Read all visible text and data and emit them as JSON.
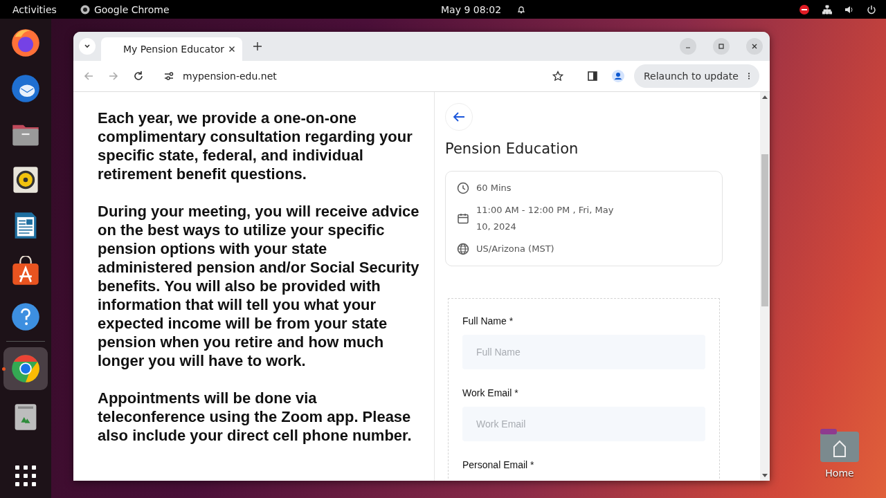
{
  "top_bar": {
    "activities": "Activities",
    "app_name": "Google Chrome",
    "clock": "May 9  08:02"
  },
  "dock": {
    "items": [
      {
        "kind": "firefox",
        "active": false
      },
      {
        "kind": "thunderbird",
        "active": false
      },
      {
        "kind": "files",
        "active": false
      },
      {
        "kind": "rhythmbox",
        "active": false
      },
      {
        "kind": "writer",
        "active": false
      },
      {
        "kind": "appcenter",
        "active": false
      },
      {
        "kind": "help",
        "active": false
      },
      {
        "kind": "chrome",
        "active": true
      },
      {
        "kind": "trash",
        "active": false
      }
    ]
  },
  "desktop": {
    "home_label": "Home"
  },
  "browser": {
    "tab_title": "My Pension Educator",
    "url": "mypension-edu.net",
    "relaunch": "Relaunch to update"
  },
  "page": {
    "paragraphs": [
      "Each year, we provide a one-on-one complimentary consultation regarding your specific state, federal, and individual retirement benefit questions.",
      "During your meeting, you will receive advice on the best ways to utilize your specific pension options with your state administered pension and/or Social Security benefits. You will also be provided with information that will tell you what your expected income will be from your state pension when you retire and how much longer you will have to work.",
      "Appointments will be done via teleconference using the Zoom app. Please also include your direct cell phone number."
    ],
    "title": "Pension Education",
    "details": [
      {
        "kind": "clock",
        "text": "60 Mins"
      },
      {
        "kind": "calendar",
        "text": "11:00 AM - 12:00 PM , Fri, May 10, 2024"
      },
      {
        "kind": "globe",
        "text": "US/Arizona (MST)"
      }
    ],
    "fields": [
      {
        "label": "Full Name *",
        "placeholder": "Full Name"
      },
      {
        "label": "Work Email *",
        "placeholder": "Work Email"
      },
      {
        "label": "Personal Email *"
      }
    ]
  }
}
